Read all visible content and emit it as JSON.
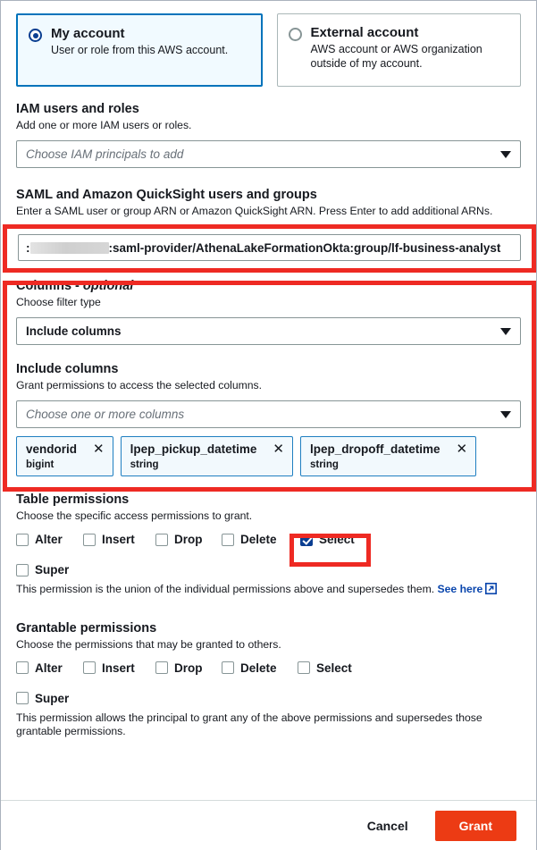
{
  "account_type": {
    "options": [
      {
        "title": "My account",
        "desc": "User or role from this AWS account.",
        "selected": true
      },
      {
        "title": "External account",
        "desc": "AWS account or AWS organization outside of my account.",
        "selected": false
      }
    ]
  },
  "iam": {
    "title": "IAM users and roles",
    "desc": "Add one or more IAM users or roles.",
    "placeholder": "Choose IAM principals to add"
  },
  "saml": {
    "title": "SAML and Amazon QuickSight users and groups",
    "desc": "Enter a SAML user or group ARN or Amazon QuickSight ARN. Press Enter to add additional ARNs.",
    "value_prefix": ":",
    "value_suffix": ":saml-provider/AthenaLakeFormationOkta:group/lf-business-analyst",
    "redacted": true
  },
  "columns": {
    "title": "Columns - ",
    "title_optional": "optional",
    "filter_label": "Choose filter type",
    "filter_value": "Include columns",
    "include_title": "Include columns",
    "include_desc": "Grant permissions to access the selected columns.",
    "include_placeholder": "Choose one or more columns",
    "chips": [
      {
        "name": "vendorid",
        "type": "bigint"
      },
      {
        "name": "lpep_pickup_datetime",
        "type": "string"
      },
      {
        "name": "lpep_dropoff_datetime",
        "type": "string"
      }
    ]
  },
  "table_permissions": {
    "title": "Table permissions",
    "desc": "Choose the specific access permissions to grant.",
    "items": [
      {
        "label": "Alter",
        "checked": false
      },
      {
        "label": "Insert",
        "checked": false
      },
      {
        "label": "Drop",
        "checked": false
      },
      {
        "label": "Delete",
        "checked": false
      },
      {
        "label": "Select",
        "checked": true
      }
    ],
    "super_label": "Super",
    "super_checked": false,
    "super_note": "This permission is the union of the individual permissions above and supersedes them.",
    "super_link": "See here"
  },
  "grantable_permissions": {
    "title": "Grantable permissions",
    "desc": "Choose the permissions that may be granted to others.",
    "items": [
      {
        "label": "Alter",
        "checked": false
      },
      {
        "label": "Insert",
        "checked": false
      },
      {
        "label": "Drop",
        "checked": false
      },
      {
        "label": "Delete",
        "checked": false
      },
      {
        "label": "Select",
        "checked": false
      }
    ],
    "super_label": "Super",
    "super_checked": false,
    "super_note": "This permission allows the principal to grant any of the above permissions and supersedes those grantable permissions."
  },
  "footer": {
    "cancel_label": "Cancel",
    "grant_label": "Grant"
  },
  "colors": {
    "highlight": "#ee2a23",
    "grant_button": "#ec3b14",
    "selected_card": "#f1faff",
    "accent_blue": "#0073bb",
    "checkbox_blue": "#0a3e91",
    "link_blue": "#0a46ad"
  }
}
